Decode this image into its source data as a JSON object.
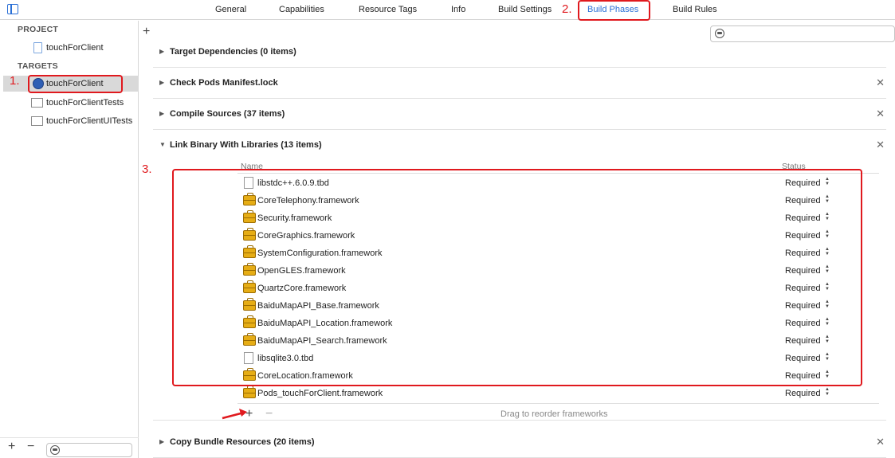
{
  "tabs": [
    {
      "label": "General"
    },
    {
      "label": "Capabilities"
    },
    {
      "label": "Resource Tags"
    },
    {
      "label": "Info"
    },
    {
      "label": "Build Settings"
    },
    {
      "label": "Build Phases"
    },
    {
      "label": "Build Rules"
    }
  ],
  "sidebar": {
    "project_label": "PROJECT",
    "project_item": "touchForClient",
    "targets_label": "TARGETS",
    "targets": [
      {
        "label": "touchForClient"
      },
      {
        "label": "touchForClientTests"
      },
      {
        "label": "touchForClientUITests"
      }
    ]
  },
  "phases": [
    {
      "title": "Target Dependencies (0 items)"
    },
    {
      "title": "Check Pods Manifest.lock"
    },
    {
      "title": "Compile Sources (37 items)"
    },
    {
      "title": "Link Binary With Libraries (13 items)"
    },
    {
      "title": "Copy Bundle Resources (20 items)"
    }
  ],
  "libraries": {
    "col_name": "Name",
    "col_status": "Status",
    "items": [
      {
        "name": "libstdc++.6.0.9.tbd",
        "status": "Required",
        "kind": "tbd"
      },
      {
        "name": "CoreTelephony.framework",
        "status": "Required",
        "kind": "framework"
      },
      {
        "name": "Security.framework",
        "status": "Required",
        "kind": "framework"
      },
      {
        "name": "CoreGraphics.framework",
        "status": "Required",
        "kind": "framework"
      },
      {
        "name": "SystemConfiguration.framework",
        "status": "Required",
        "kind": "framework"
      },
      {
        "name": "OpenGLES.framework",
        "status": "Required",
        "kind": "framework"
      },
      {
        "name": "QuartzCore.framework",
        "status": "Required",
        "kind": "framework"
      },
      {
        "name": "BaiduMapAPI_Base.framework",
        "status": "Required",
        "kind": "framework"
      },
      {
        "name": "BaiduMapAPI_Location.framework",
        "status": "Required",
        "kind": "framework"
      },
      {
        "name": "BaiduMapAPI_Search.framework",
        "status": "Required",
        "kind": "framework"
      },
      {
        "name": "libsqlite3.0.tbd",
        "status": "Required",
        "kind": "tbd"
      },
      {
        "name": "CoreLocation.framework",
        "status": "Required",
        "kind": "framework"
      },
      {
        "name": "Pods_touchForClient.framework",
        "status": "Required",
        "kind": "framework"
      }
    ],
    "drag_hint": "Drag to reorder frameworks"
  },
  "annotations": {
    "step1": "1.",
    "step2": "2.",
    "step3": "3."
  },
  "colors": {
    "accent": "#2a6fd6",
    "annotation": "#e0191e"
  }
}
